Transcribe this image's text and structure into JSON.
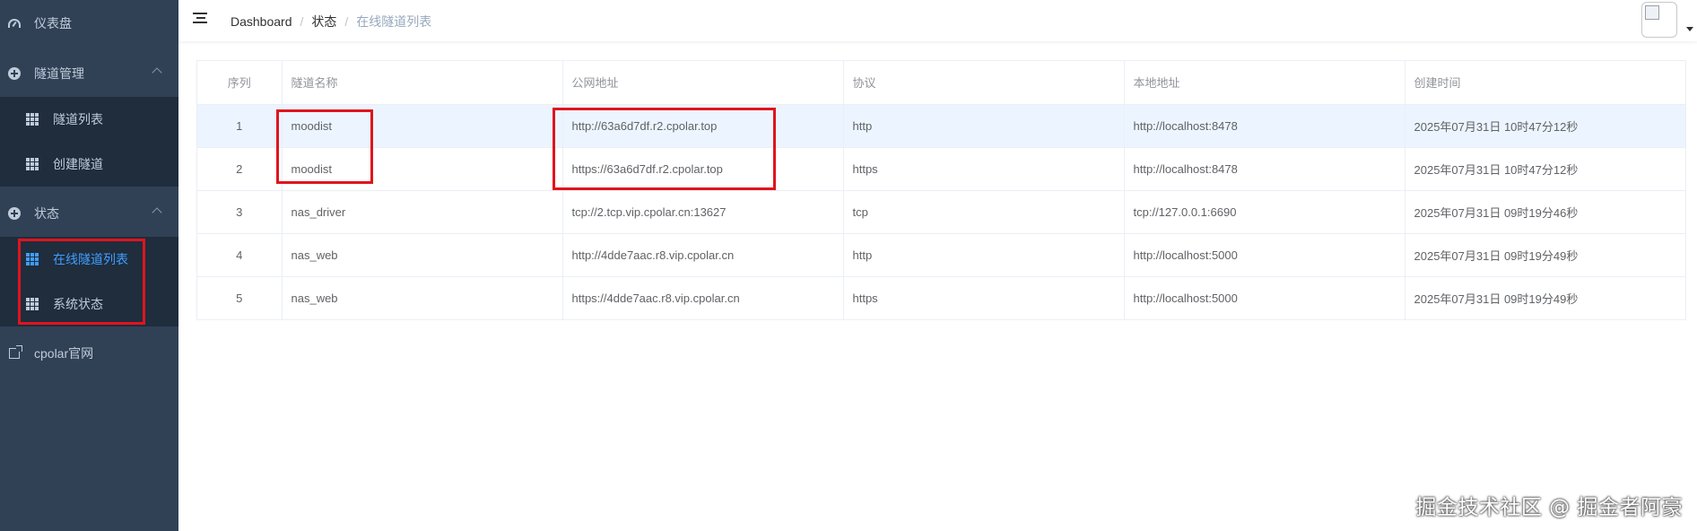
{
  "sidebar": {
    "dashboard": "仪表盘",
    "tunnel_mgmt": {
      "label": "隧道管理",
      "items": [
        "隧道列表",
        "创建隧道"
      ]
    },
    "status": {
      "label": "状态",
      "items": [
        "在线隧道列表",
        "系统状态"
      ]
    },
    "official_site": "cpolar官网",
    "colors": {
      "bg": "#304156",
      "submenu_bg": "#1f2d3d",
      "text": "#bfcbd9",
      "active": "#409eff"
    }
  },
  "navbar": {
    "breadcrumb": [
      "Dashboard",
      "状态",
      "在线隧道列表"
    ],
    "separator": "/"
  },
  "table": {
    "columns": [
      "序列",
      "隧道名称",
      "公网地址",
      "协议",
      "本地地址",
      "创建时间"
    ],
    "rows": [
      [
        "1",
        "moodist",
        "http://63a6d7df.r2.cpolar.top",
        "http",
        "http://localhost:8478",
        "2025年07月31日 10时47分12秒"
      ],
      [
        "2",
        "moodist",
        "https://63a6d7df.r2.cpolar.top",
        "https",
        "http://localhost:8478",
        "2025年07月31日 10时47分12秒"
      ],
      [
        "3",
        "nas_driver",
        "tcp://2.tcp.vip.cpolar.cn:13627",
        "tcp",
        "tcp://127.0.0.1:6690",
        "2025年07月31日 09时19分46秒"
      ],
      [
        "4",
        "nas_web",
        "http://4dde7aac.r8.vip.cpolar.cn",
        "http",
        "http://localhost:5000",
        "2025年07月31日 09时19分49秒"
      ],
      [
        "5",
        "nas_web",
        "https://4dde7aac.r8.vip.cpolar.cn",
        "https",
        "http://localhost:5000",
        "2025年07月31日 09时19分49秒"
      ]
    ],
    "highlight_color": "#ecf5ff"
  },
  "watermark": "掘金技术社区 @ 掘金者阿豪",
  "annotation_color": "#e0141e"
}
